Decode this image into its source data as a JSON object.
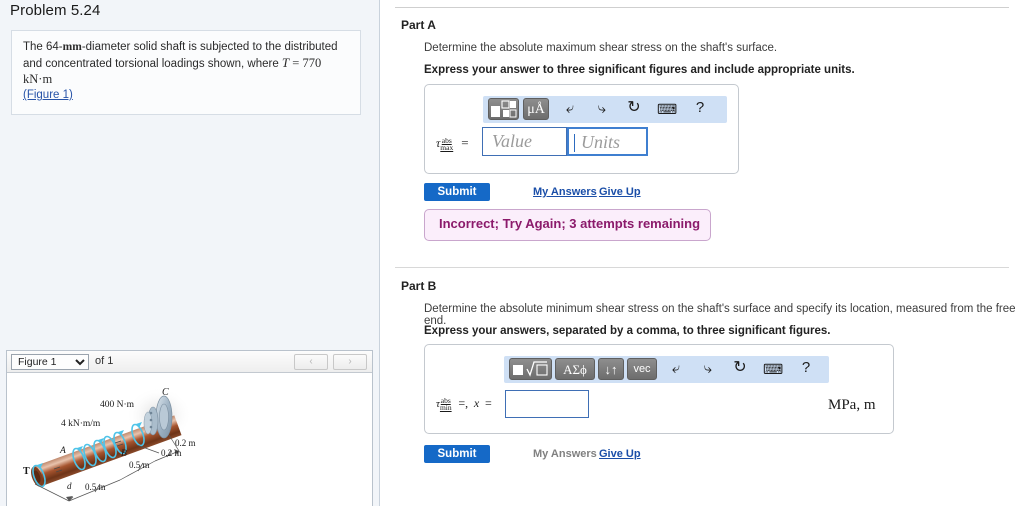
{
  "problem": {
    "title": "Problem 5.24",
    "text_part1": "The 64-",
    "text_mm": "mm",
    "text_part2": "-diameter solid shaft is subjected to the distributed and concentrated torsional loadings shown, where ",
    "symbol_T": "T",
    "equals": "=",
    "value_T": "770 kN·m",
    "figure_link": "(Figure 1)"
  },
  "figure_panel": {
    "select_value": "Figure 1",
    "select_options": [
      "Figure 1"
    ],
    "of_label": "of 1",
    "prev_icon": "‹",
    "next_icon": "›",
    "diagram": {
      "labels": {
        "torque_400": "400 N·m",
        "distributed": "4 kN·m/m",
        "point_A": "A",
        "point_B": "B",
        "point_C": "C",
        "point_d": "d",
        "torque_T": "T",
        "dim_02_a": "0.2 m",
        "dim_02_b": "0.2 m",
        "dim_05_a": "0.5 m",
        "dim_05_b": "0.5 m"
      }
    }
  },
  "partA": {
    "label": "Part A",
    "question": "Determine the absolute maximum shear stress on the shaft's surface.",
    "instruction": "Express your answer to three significant figures and include appropriate units.",
    "tau_symbol": "τ",
    "tau_sub_top": "abs",
    "tau_sub_bottom": "max",
    "equals": "=",
    "value_placeholder": "Value",
    "units_placeholder": "Units",
    "toolbar": [
      {
        "name": "template-icon",
        "glyph": "■"
      },
      {
        "name": "units-icon",
        "glyph": "μÅ"
      },
      {
        "name": "undo-icon",
        "glyph": "↩"
      },
      {
        "name": "redo-icon",
        "glyph": "↪"
      },
      {
        "name": "reset-icon",
        "glyph": "↻"
      },
      {
        "name": "keyboard-icon",
        "glyph": "⌨"
      },
      {
        "name": "help-icon",
        "glyph": "?"
      }
    ],
    "submit_label": "Submit",
    "my_answers_label": "My Answers",
    "give_up_label": "Give Up",
    "feedback": "Incorrect; Try Again; 3 attempts remaining"
  },
  "partB": {
    "label": "Part B",
    "question": "Determine the absolute minimum shear stress on the shaft's surface and specify its location, measured from the free end.",
    "instruction": "Express your answers, separated by a comma, to three significant figures.",
    "tau_symbol": "τ",
    "tau_sub_top": "abs",
    "tau_sub_bottom": "min",
    "equals_comma": "=,",
    "x_symbol": "x",
    "equals": "=",
    "input_value": "",
    "units_text": "MPa, m",
    "toolbar": [
      {
        "name": "sqrt-template-icon",
        "glyph": "√"
      },
      {
        "name": "greek-icon",
        "glyph": "ΑΣϕ"
      },
      {
        "name": "arrows-icon",
        "glyph": "↓↑"
      },
      {
        "name": "vector-icon",
        "glyph": "vec"
      },
      {
        "name": "undo-icon",
        "glyph": "↩"
      },
      {
        "name": "redo-icon",
        "glyph": "↪"
      },
      {
        "name": "reset-icon",
        "glyph": "↻"
      },
      {
        "name": "keyboard-icon",
        "glyph": "⌨"
      },
      {
        "name": "help-icon",
        "glyph": "?"
      }
    ],
    "submit_label": "Submit",
    "my_answers_label": "My Answers",
    "give_up_label": "Give Up"
  },
  "colors": {
    "accent_blue": "#1569c7",
    "link_blue": "#1a4ea8",
    "toolbar_bg": "#cfe0f5",
    "feedback_bg": "#fbeefb",
    "feedback_text": "#8b1a6b",
    "panel_bg": "#f2f5f9"
  }
}
